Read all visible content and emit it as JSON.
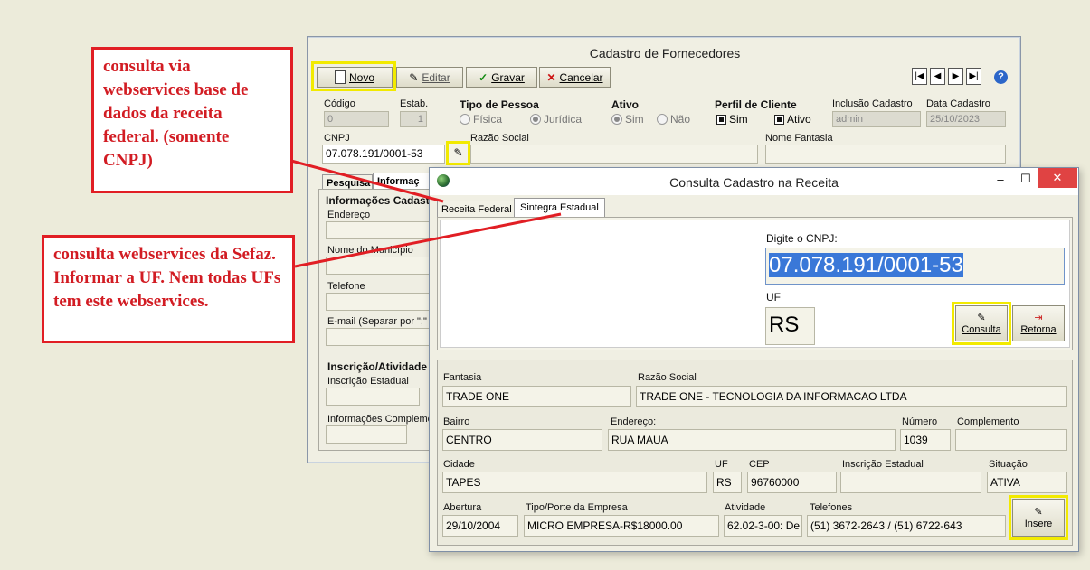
{
  "main_window": {
    "title": "Cadastro de Fornecedores",
    "toolbar": {
      "novo": "Novo",
      "editar": "Editar",
      "gravar": "Gravar",
      "cancelar": "Cancelar",
      "help": "?"
    },
    "nav": {
      "first": "|◀",
      "prev": "◀",
      "next": "▶",
      "last": "▶|"
    },
    "labels": {
      "codigo": "Código",
      "estab": "Estab.",
      "tipo_pessoa": "Tipo de Pessoa",
      "fisica": "Física",
      "juridica": "Jurídica",
      "ativo": "Ativo",
      "sim": "Sim",
      "nao": "Não",
      "perfil_cliente": "Perfil de Cliente",
      "perfil_sim": "Sim",
      "perfil_ativo": "Ativo",
      "inclusao": "Inclusão Cadastro",
      "data_cadastro": "Data Cadastro",
      "cnpj": "CNPJ",
      "razao_social": "Razão Social",
      "nome_fantasia": "Nome Fantasia"
    },
    "values": {
      "codigo": "0",
      "estab": "1",
      "inclusao": "admin",
      "data_cadastro": "25/10/2023",
      "cnpj": "07.078.191/0001-53"
    },
    "tabs": {
      "pesquisa": "Pesquisa",
      "informacoes": "Informaç"
    },
    "panel": {
      "group_title": "Informações Cadastr",
      "endereco": "Endereço",
      "municipio": "Nome do Município",
      "telefone": "Telefone",
      "email": "E-mail (Separar por \";\" p",
      "inscricao_title": "Inscrição/Atividade",
      "inscricao_estadual": "Inscrição Estadual",
      "info_compl": "Informações Complemer"
    }
  },
  "dialog": {
    "title": "Consulta Cadastro na Receita",
    "controls": {
      "min": "–",
      "max": "☐",
      "close": "✕"
    },
    "tabs": {
      "receita": "Receita Federal",
      "sintegra": "Sintegra Estadual"
    },
    "cnpj_label": "Digite o CNPJ:",
    "cnpj_value": "07.078.191/0001-53",
    "uf_label": "UF",
    "uf_value": "RS",
    "consulta_btn": "Consulta",
    "retorna_btn": "Retorna",
    "insere_btn": "Insere",
    "labels": {
      "fantasia": "Fantasia",
      "razao": "Razão Social",
      "bairro": "Bairro",
      "endereco": "Endereço:",
      "numero": "Número",
      "complemento": "Complemento",
      "cidade": "Cidade",
      "uf": "UF",
      "cep": "CEP",
      "inscricao": "Inscrição Estadual",
      "situacao": "Situação",
      "abertura": "Abertura",
      "tipo_porte": "Tipo/Porte da Empresa",
      "atividade": "Atividade",
      "telefones": "Telefones"
    },
    "values": {
      "fantasia": "TRADE ONE",
      "razao": "TRADE ONE - TECNOLOGIA DA INFORMACAO LTDA",
      "bairro": "CENTRO",
      "endereco": "RUA MAUA",
      "numero": "1039",
      "complemento": "",
      "cidade": "TAPES",
      "uf": "RS",
      "cep": "96760000",
      "inscricao": "",
      "situacao": "ATIVA",
      "abertura": "29/10/2004",
      "tipo_porte": "MICRO EMPRESA-R$18000.00",
      "atividade": "62.02-3-00: De",
      "telefones": "(51) 3672-2643 / (51) 6722-643"
    }
  },
  "annotations": {
    "note1": "consulta via webservices base de dados da receita federal. (somente CNPJ)",
    "note2": "consulta webservices da Sefaz. Informar a UF. Nem todas UFs tem este webservices."
  },
  "colors": {
    "highlight": "#f2ea00",
    "annotation": "#e11e24",
    "selection": "#3a78d8"
  }
}
